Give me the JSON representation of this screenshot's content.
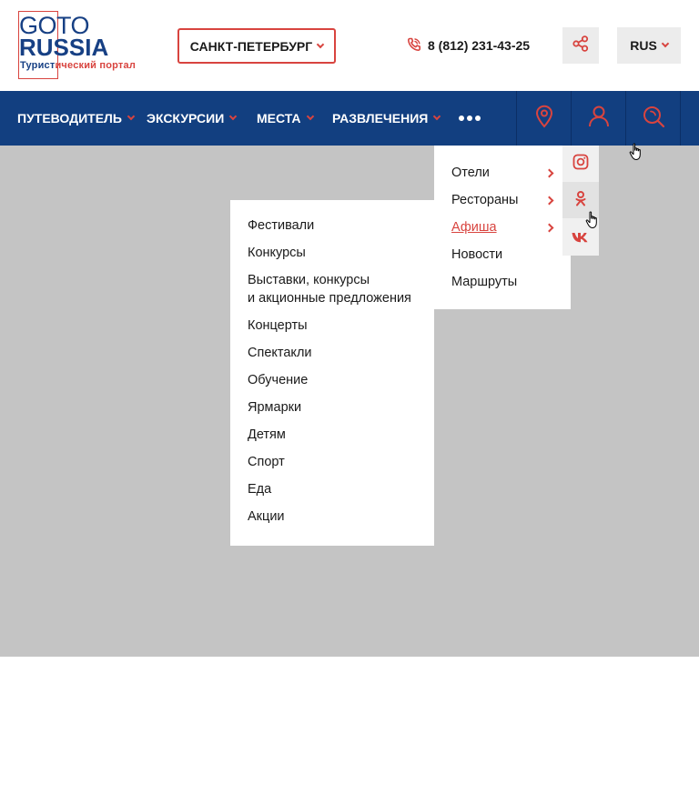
{
  "logo": {
    "go_light": "GO",
    "go_bold": "TO",
    "russia": "RUSSIA",
    "tagline_part1": "Турист",
    "tagline_part2": "ический портал"
  },
  "header": {
    "city": "САНКТ-ПЕТЕРБУРГ",
    "phone": "8 (812) 231-43-25",
    "language": "RUS"
  },
  "nav": {
    "items": [
      {
        "label": "ПУТЕВОДИТЕЛЬ"
      },
      {
        "label": "ЭКСКУРСИИ"
      },
      {
        "label": "МЕСТА"
      },
      {
        "label": "РАЗВЛЕЧЕНИЯ"
      }
    ],
    "icons": [
      "location-pin-icon",
      "user-icon",
      "search-icon"
    ]
  },
  "dropdown": {
    "items": [
      {
        "label": "Отели",
        "has_submenu": true
      },
      {
        "label": "Рестораны",
        "has_submenu": true
      },
      {
        "label": "Афиша",
        "has_submenu": true,
        "active": true
      },
      {
        "label": "Новости",
        "has_submenu": false
      },
      {
        "label": "Маршруты",
        "has_submenu": false
      }
    ]
  },
  "submenu": {
    "items": [
      {
        "label": "Фестивали"
      },
      {
        "label": "Конкурсы"
      },
      {
        "label": "Выставки, конкурсы\nи акционные предложения"
      },
      {
        "label": "Концерты"
      },
      {
        "label": "Спектакли"
      },
      {
        "label": "Обучение"
      },
      {
        "label": "Ярмарки"
      },
      {
        "label": "Детям"
      },
      {
        "label": "Спорт"
      },
      {
        "label": "Еда"
      },
      {
        "label": "Акции"
      }
    ]
  },
  "social": [
    "instagram-icon",
    "odnoklassniki-icon",
    "vk-icon"
  ],
  "colors": {
    "brand_blue": "#123f80",
    "accent_red": "#d8443f",
    "overlay": "#c4c4c4"
  }
}
